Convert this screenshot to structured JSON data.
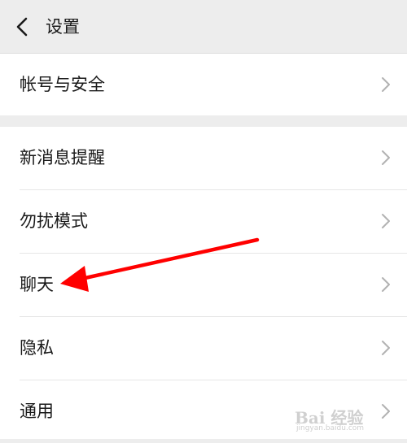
{
  "header": {
    "back_icon": "chevron-left-icon",
    "title": "设置"
  },
  "groups": [
    {
      "items": [
        {
          "label": "帐号与安全",
          "icon": "chevron-right-icon"
        }
      ]
    },
    {
      "items": [
        {
          "label": "新消息提醒",
          "icon": "chevron-right-icon"
        },
        {
          "label": "勿扰模式",
          "icon": "chevron-right-icon"
        },
        {
          "label": "聊天",
          "icon": "chevron-right-icon"
        },
        {
          "label": "隐私",
          "icon": "chevron-right-icon"
        },
        {
          "label": "通用",
          "icon": "chevron-right-icon"
        }
      ]
    }
  ],
  "annotation": {
    "arrow_color": "#ff0000",
    "target": "聊天"
  },
  "watermark": {
    "logo": "Bai 经验",
    "url": "jingyan.baidu.com"
  },
  "colors": {
    "background": "#ededed",
    "row": "#ffffff",
    "text": "#1a1a1a",
    "chevron": "#b2b2b2"
  }
}
